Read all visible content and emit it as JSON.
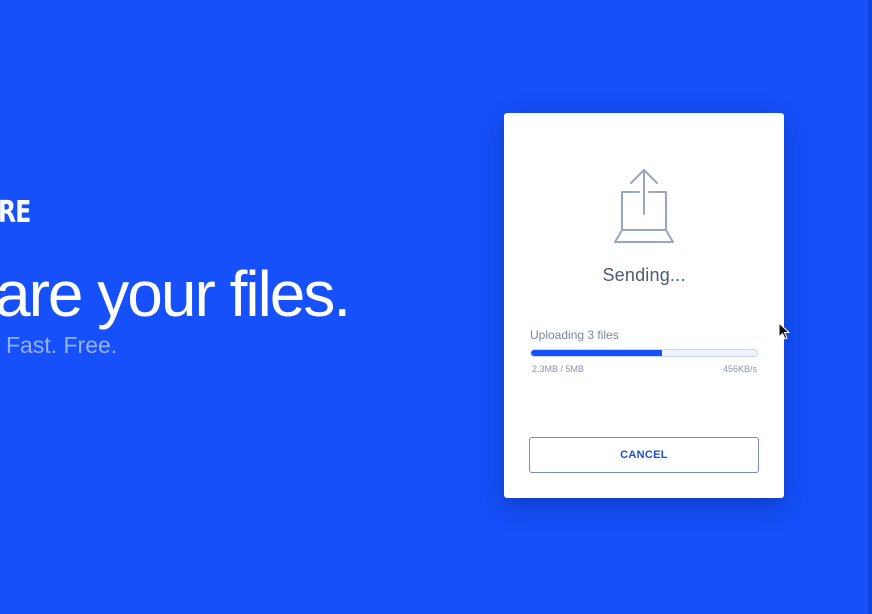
{
  "hero": {
    "brand_fragment": "RE",
    "headline": "are your files.",
    "tagline": "Fast. Free."
  },
  "dialog": {
    "icon": "upload-laptop-icon",
    "status_title": "Sending...",
    "progress": {
      "label": "Uploading 3 files",
      "fraction": 0.58,
      "size_text": "2.3MB / 5MB",
      "rate_text": "456KB/s"
    },
    "cancel_label": "CANCEL"
  },
  "colors": {
    "background": "#1550fa",
    "accent": "#1550fa",
    "card": "#ffffff",
    "icon_stroke": "#9aa6bf"
  }
}
